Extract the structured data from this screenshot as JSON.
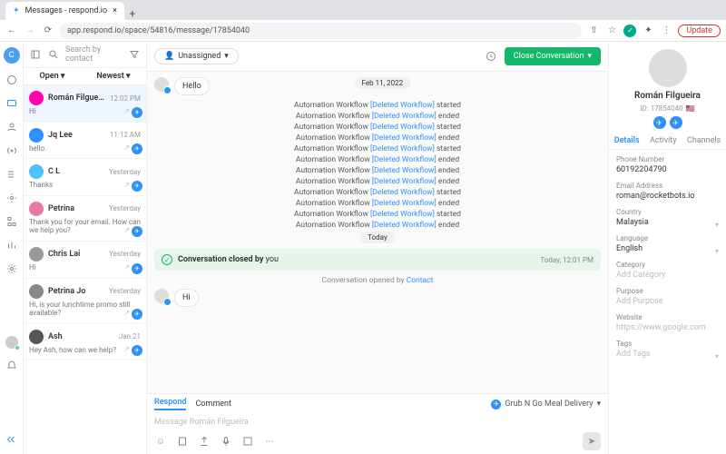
{
  "browser": {
    "tab_title": "Messages - respond.io",
    "url": "app.respond.io/space/54816/message/17854040",
    "update_label": "Update"
  },
  "rail": {
    "initial": "C"
  },
  "convlist": {
    "search_placeholder": "Search by contact",
    "filter_open": "Open ▾",
    "filter_sort": "Newest ▾",
    "items": [
      {
        "name": "Román Filgueira",
        "time": "12:02 PM",
        "snippet": "Hi",
        "sel": true,
        "color": "#f0a"
      },
      {
        "name": "Jq Lee",
        "time": "11:12 AM",
        "snippet": "hello.",
        "color": "#2e90fa"
      },
      {
        "name": "C L",
        "time": "Yesterday",
        "snippet": "Thanks",
        "color": "#4cc3ff"
      },
      {
        "name": "Petrina",
        "time": "Yesterday",
        "snippet": "Thank you for your email. How can we help you?",
        "color": "#e879a6"
      },
      {
        "name": "Chris Lai",
        "time": "Yesterday",
        "snippet": "Hi",
        "color": "#999"
      },
      {
        "name": "Petrina Jo",
        "time": "Yesterday",
        "snippet": "Hi, is your lunchtime promo still available?",
        "color": "#888"
      },
      {
        "name": "Ash",
        "time": "Jan 21",
        "snippet": "Hey Ash, how can we help?",
        "color": "#555"
      }
    ]
  },
  "chat": {
    "assign_label": "Unassigned",
    "close_btn": "Close Conversation",
    "hello": "Hello",
    "date": "Feb 11, 2022",
    "wf_prefix": "Automation Workflow ",
    "wf_link": "[Deleted Workflow]",
    "states": [
      "started",
      "ended",
      "started",
      "ended",
      "started",
      "ended",
      "ended",
      "ended",
      "started",
      "ended",
      "started",
      "ended"
    ],
    "today": "Today",
    "closed_text": "Conversation closed by ",
    "closed_by": "you",
    "closed_time": "Today, 12:01 PM",
    "opened_text": "Conversation opened by ",
    "opened_by": "Contact",
    "hi": "Hi",
    "tabs": {
      "respond": "Respond",
      "comment": "Comment"
    },
    "channel": "Grub N Go Meal Delivery",
    "input_placeholder": "Message Román Filgueira"
  },
  "profile": {
    "name": "Román Filgueira",
    "id": "ID: 17854040",
    "tabs": {
      "details": "Details",
      "activity": "Activity",
      "channels": "Channels"
    },
    "fields": {
      "phone_l": "Phone Number",
      "phone_v": "60192204790",
      "email_l": "Email Address",
      "email_v": "roman@rocketbots.io",
      "country_l": "Country",
      "country_v": "Malaysia",
      "lang_l": "Language",
      "lang_v": "English",
      "cat_l": "Category",
      "cat_ph": "Add Category",
      "purpose_l": "Purpose",
      "purpose_ph": "Add Purpose",
      "web_l": "Website",
      "web_ph": "https://www.google.com",
      "tags_l": "Tags",
      "tags_ph": "Add Tags"
    }
  }
}
